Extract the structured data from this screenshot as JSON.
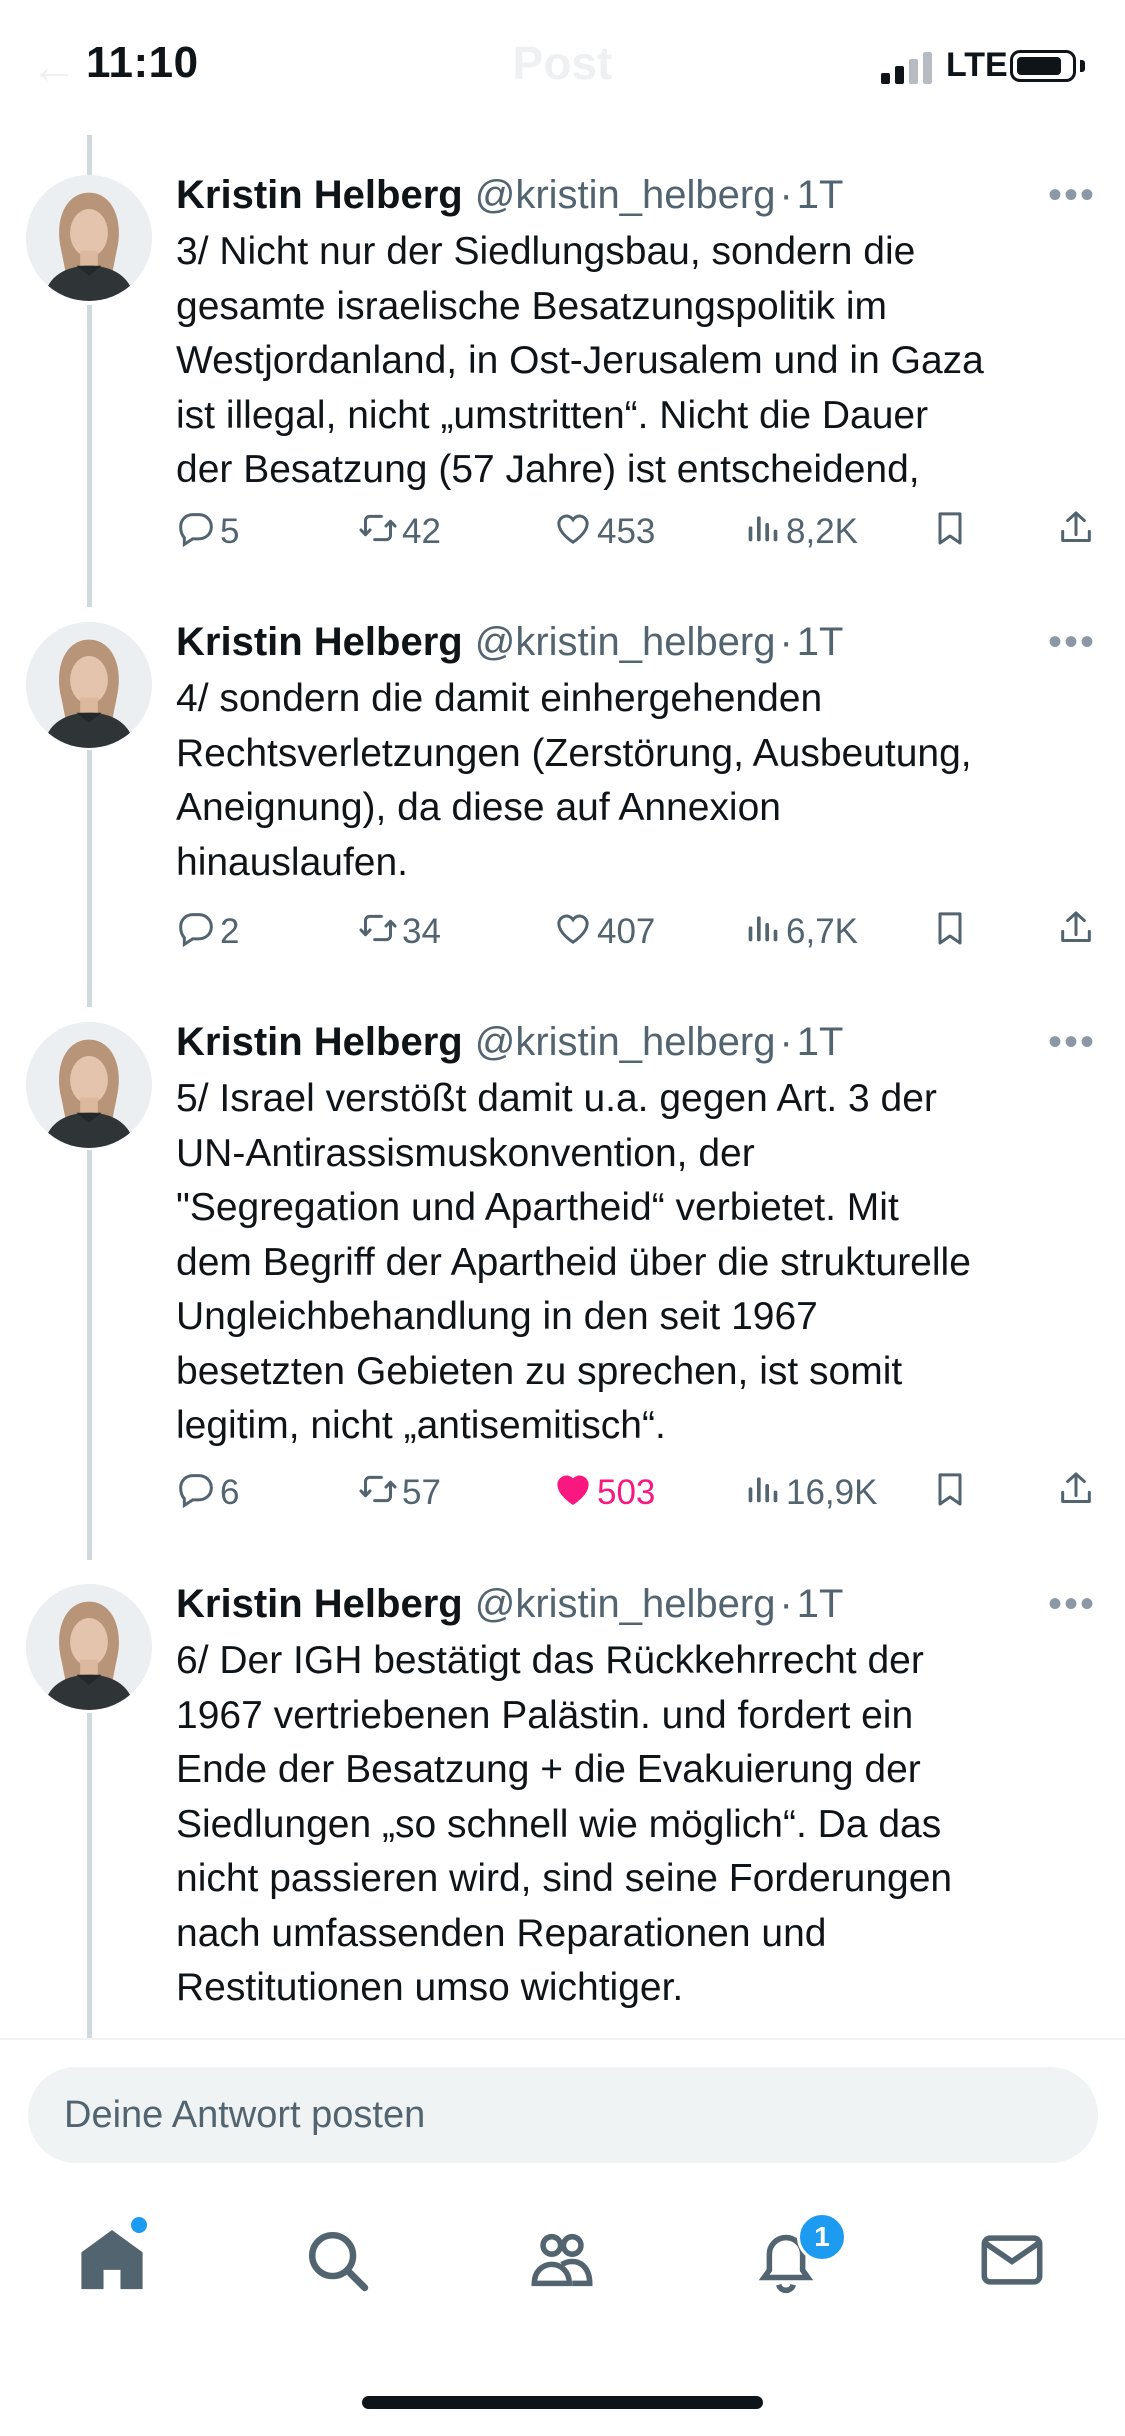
{
  "status_bar": {
    "time": "11:10",
    "network": "LTE"
  },
  "header": {
    "title": "Post"
  },
  "tweets": [
    {
      "author": "Kristin Helberg",
      "handle": "@kristin_helberg",
      "separator": "·",
      "time_ago": "1T",
      "lines": [
        "3/ Nicht nur der Siedlungsbau, sondern die",
        "gesamte israelische Besatzungspolitik im",
        "Westjordanland, in Ost-Jerusalem und in Gaza",
        "ist illegal, nicht „umstritten“. Nicht die Dauer",
        "der Besatzung (57 Jahre) ist entscheidend,"
      ],
      "replies": "5",
      "reposts": "42",
      "likes": "453",
      "views": "8,2K",
      "liked": false
    },
    {
      "author": "Kristin Helberg",
      "handle": "@kristin_helberg",
      "separator": "·",
      "time_ago": "1T",
      "lines": [
        "4/ sondern die damit einhergehenden",
        "Rechtsverletzungen (Zerstörung, Ausbeutung,",
        "Aneignung), da diese auf Annexion",
        "hinauslaufen."
      ],
      "replies": "2",
      "reposts": "34",
      "likes": "407",
      "views": "6,7K",
      "liked": false
    },
    {
      "author": "Kristin Helberg",
      "handle": "@kristin_helberg",
      "separator": "·",
      "time_ago": "1T",
      "lines": [
        "5/ Israel verstößt damit u.a. gegen Art. 3 der",
        "UN-Antirassismuskonvention, der",
        "\"Segregation und Apartheid“ verbietet. Mit",
        "dem Begriff der Apartheid über die strukturelle",
        "Ungleichbehandlung in den seit 1967",
        "besetzten Gebieten zu sprechen, ist somit",
        "legitim, nicht „antisemitisch“."
      ],
      "replies": "6",
      "reposts": "57",
      "likes": "503",
      "views": "16,9K",
      "liked": true
    },
    {
      "author": "Kristin Helberg",
      "handle": "@kristin_helberg",
      "separator": "·",
      "time_ago": "1T",
      "lines": [
        "6/ Der IGH bestätigt das Rückkehrrecht der",
        "1967 vertriebenen Palästin. und fordert ein",
        "Ende der Besatzung + die Evakuierung der",
        "Siedlungen „so schnell wie möglich“. Da das",
        "nicht passieren wird, sind seine Forderungen",
        "nach umfassenden Reparationen und",
        "Restitutionen umso wichtiger."
      ]
    }
  ],
  "reply_box": {
    "placeholder": "Deine Antwort posten"
  },
  "tab_bar": {
    "notifications_badge": "1"
  },
  "colors": {
    "accent": "#1d9bf0",
    "like": "#f91880",
    "muted": "#536471"
  }
}
